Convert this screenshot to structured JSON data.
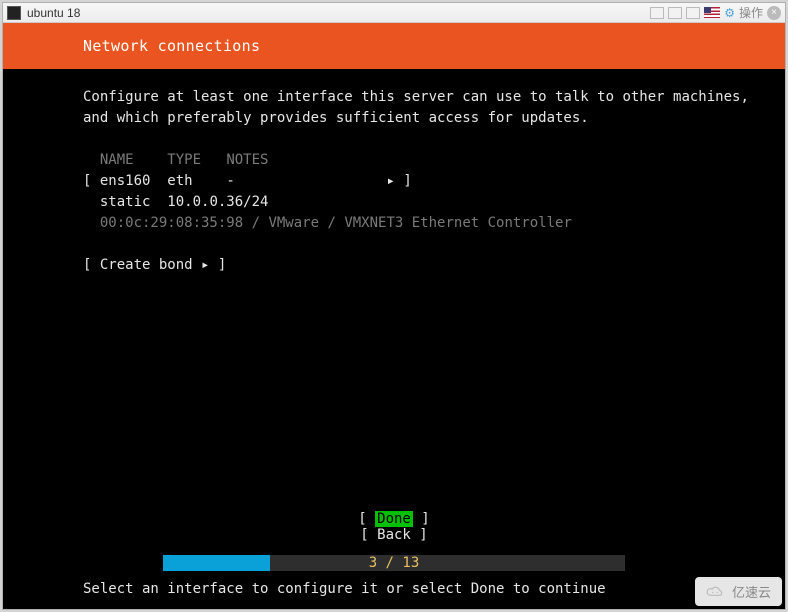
{
  "titlebar": {
    "title": "ubuntu 18",
    "operate_label": "操作"
  },
  "header": {
    "title": "Network connections"
  },
  "body": {
    "instruction_line1": "Configure at least one interface this server can use to talk to other machines,",
    "instruction_line2": "and which preferably provides sufficient access for updates.",
    "columns": {
      "name": "NAME",
      "type": "TYPE",
      "notes": "NOTES"
    },
    "iface": {
      "name": "ens160",
      "type": "eth",
      "notes": "-",
      "mode": "static",
      "address": "10.0.0.36/24",
      "mac": "00:0c:29:08:35:98",
      "vendor": "VMware",
      "model": "VMXNET3 Ethernet Controller"
    },
    "create_bond": "Create bond"
  },
  "actions": {
    "done": "Done",
    "back": "Back"
  },
  "progress": {
    "current": 3,
    "total": 13,
    "label": "3 / 13"
  },
  "hint": "Select an interface to configure it or select Done to continue",
  "watermark": "亿速云"
}
